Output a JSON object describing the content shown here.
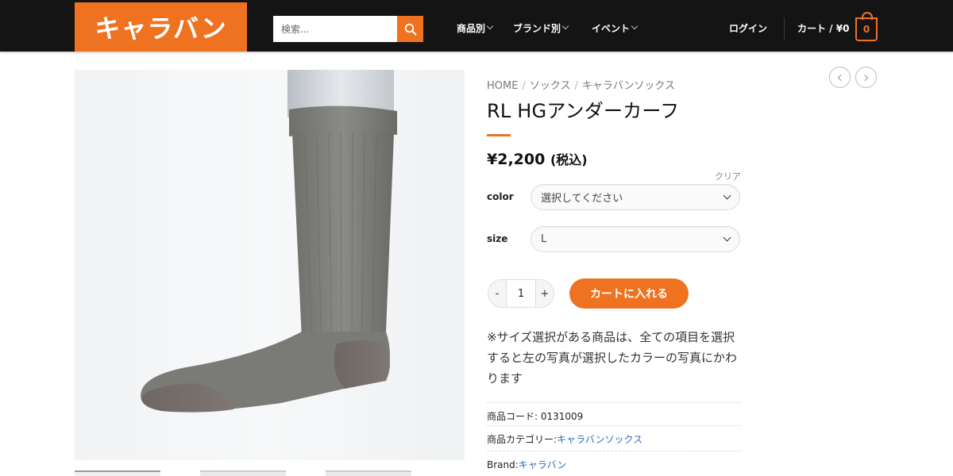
{
  "header": {
    "logo_text": "キャラバン",
    "search": {
      "placeholder": "検索..."
    },
    "nav": [
      {
        "label": "商品別"
      },
      {
        "label": "ブランド別"
      },
      {
        "label": "イベント"
      }
    ],
    "login_label": "ログイン",
    "cart_label": "カート / ¥0",
    "cart_count": "0"
  },
  "breadcrumb": {
    "items": [
      "HOME",
      "ソックス",
      "キャラバンソックス"
    ]
  },
  "product": {
    "title": "RL HGアンダーカーフ",
    "price": "¥2,200",
    "price_tax": "(税込)",
    "clear_label": "クリア",
    "options": [
      {
        "label": "color",
        "value": "選択してください"
      },
      {
        "label": "size",
        "value": "L"
      }
    ],
    "quantity": {
      "minus": "-",
      "value": "1",
      "plus": "+"
    },
    "add_to_cart_label": "カートに入れる",
    "note": "※サイズ選択がある商品は、全ての項目を選択すると左の写真が選択したカラーの写真にかわります",
    "meta": {
      "code_label": "商品コード:",
      "code_value": "0131009",
      "category_label": "商品カテゴリー:",
      "category_value": "キャラバンソックス",
      "brand_label": "Brand:",
      "brand_value": "キャラバン"
    }
  },
  "colors": {
    "accent": "#ee7220",
    "header_bg": "#141414",
    "link": "#2a6fb5"
  },
  "icons": {
    "search": "search-icon",
    "cart": "cart-icon",
    "prev": "chevron-left-icon",
    "next": "chevron-right-icon"
  }
}
